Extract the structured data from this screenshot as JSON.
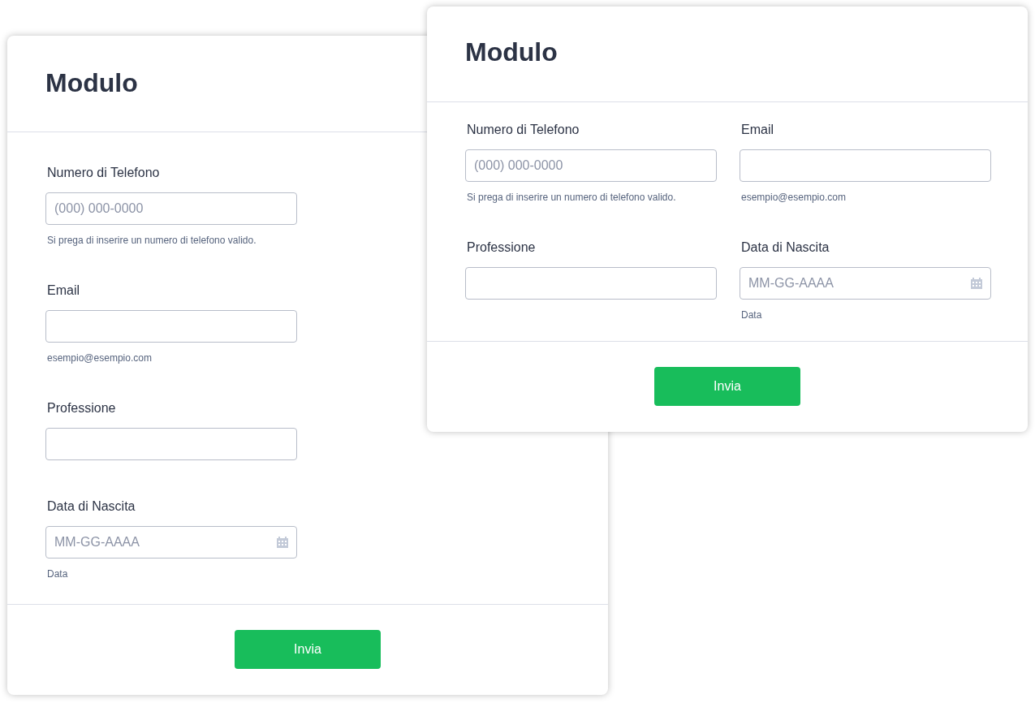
{
  "forms": [
    {
      "title": "Modulo",
      "kind": "stacked",
      "fields": [
        {
          "kind": "text",
          "label": "Numero di Telefono",
          "placeholder": "(000) 000-0000",
          "sublabel": "Si prega di inserire un numero di telefono valido."
        },
        {
          "kind": "text",
          "label": "Email",
          "sublabel": "esempio@esempio.com"
        },
        {
          "kind": "text",
          "label": "Professione"
        },
        {
          "kind": "date",
          "label": "Data di Nascita",
          "placeholder": "MM-GG-AAAA",
          "sublabel": "Data"
        }
      ],
      "submit": "Invia"
    },
    {
      "title": "Modulo",
      "kind": "grid",
      "fields": [
        {
          "kind": "text",
          "label": "Numero di Telefono",
          "placeholder": "(000) 000-0000",
          "sublabel": "Si prega di inserire un numero di telefono valido."
        },
        {
          "kind": "text",
          "label": "Email",
          "sublabel": "esempio@esempio.com"
        },
        {
          "kind": "text",
          "label": "Professione"
        },
        {
          "kind": "date",
          "label": "Data di Nascita",
          "placeholder": "MM-GG-AAAA",
          "sublabel": "Data"
        }
      ],
      "submit": "Invia"
    }
  ]
}
